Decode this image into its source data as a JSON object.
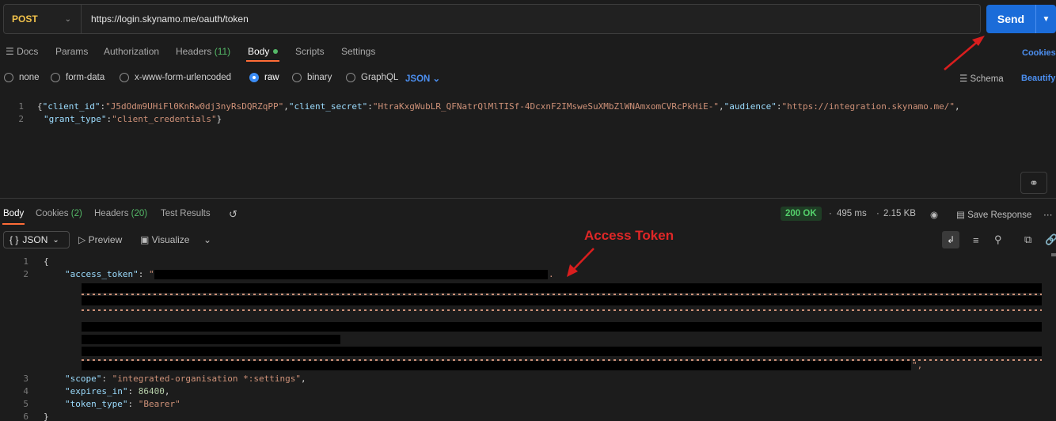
{
  "request": {
    "method": "POST",
    "url": "https://login.skynamo.me/oauth/token",
    "send_label": "Send"
  },
  "request_tabs": {
    "docs": "Docs",
    "params": "Params",
    "authorization": "Authorization",
    "headers": "Headers",
    "headers_count": "(11)",
    "body": "Body",
    "scripts": "Scripts",
    "settings": "Settings",
    "cookies": "Cookies"
  },
  "body_types": {
    "none": "none",
    "form_data": "form-data",
    "urlencoded": "x-www-form-urlencoded",
    "raw": "raw",
    "binary": "binary",
    "graphql": "GraphQL",
    "format": "JSON",
    "schema": "Schema",
    "beautify": "Beautify"
  },
  "request_body": {
    "line1_num": "1",
    "line2_num": "2",
    "client_id_key": "\"client_id\"",
    "client_id_val": "\"J5dOdm9UHiFl0KnRw0dj3nyRsDQRZqPP\"",
    "client_secret_key": "\"client_secret\"",
    "client_secret_val": "\"HtraKxgWubLR_QFNatrQlMlTISf-4DcxnF2IMsweSuXMbZlWNAmxomCVRcPkHiE-\"",
    "audience_key": "\"audience\"",
    "audience_val": "\"https://integration.skynamo.me/\"",
    "grant_type_key": "\"grant_type\"",
    "grant_type_val": "\"client_credentials\""
  },
  "response_tabs": {
    "body": "Body",
    "cookies": "Cookies",
    "cookies_count": "(2)",
    "headers": "Headers",
    "headers_count": "(20)",
    "test_results": "Test Results"
  },
  "response_meta": {
    "status": "200 OK",
    "time": "495 ms",
    "size": "2.15 KB",
    "save": "Save Response"
  },
  "response_toolbar": {
    "format": "JSON",
    "preview": "Preview",
    "visualize": "Visualize"
  },
  "response_body": {
    "ln1": "1",
    "ln2": "2",
    "ln3": "3",
    "ln4": "4",
    "ln5": "5",
    "ln6": "6",
    "open_brace": "{",
    "access_token_key": "\"access_token\"",
    "scope_key": "\"scope\"",
    "scope_val": "\"integrated-organisation *:settings\"",
    "expires_key": "\"expires_in\"",
    "expires_val": "86400",
    "token_type_key": "\"token_type\"",
    "token_type_val": "\"Bearer\"",
    "close_brace": "}"
  },
  "annotation": {
    "label": "Access Token",
    "color": "#e02727"
  },
  "colors": {
    "accent_send": "#1b6cd9",
    "method": "#f3c34b",
    "status_ok": "#54d16b",
    "active_tab": "#ff6c37"
  }
}
